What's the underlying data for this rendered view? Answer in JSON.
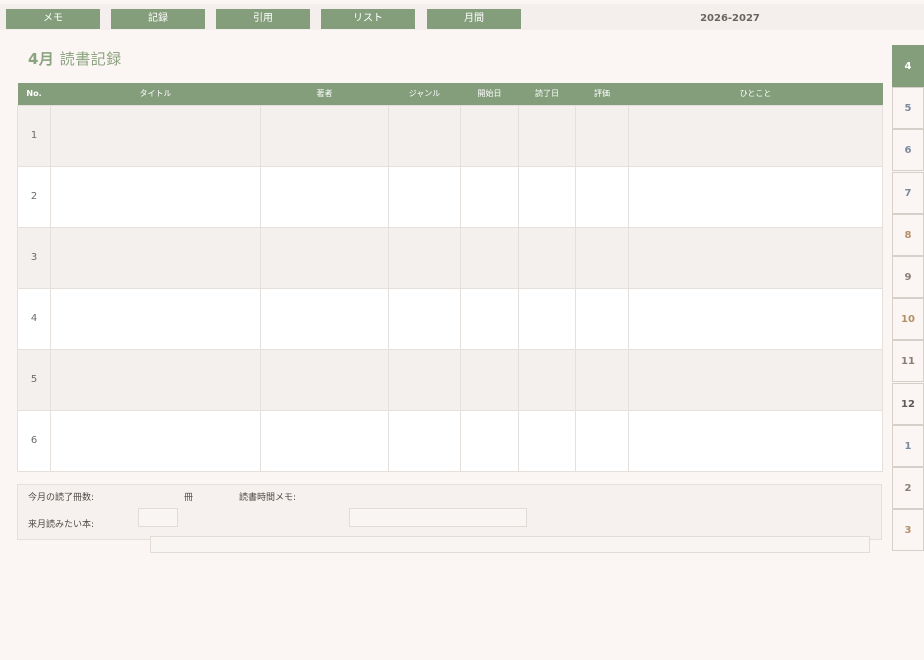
{
  "nav": {
    "buttons": [
      "メモ",
      "記録",
      "引用",
      "リスト",
      "月間"
    ],
    "year": "2026-2027"
  },
  "page": {
    "title_month": "4月",
    "title_text": " 読書記録"
  },
  "table": {
    "headers": [
      "No.",
      "タイトル",
      "著者",
      "ジャンル",
      "開始日",
      "読了日",
      "評価",
      "ひとこと"
    ],
    "rows": [
      "1",
      "2",
      "3",
      "4",
      "5",
      "6"
    ]
  },
  "footer": {
    "finished_label": "今月の読了冊数:",
    "unit": "冊",
    "memo_label": "読書時間メモ:",
    "next_label": "来月読みたい本:"
  },
  "side_tabs": {
    "labels": [
      "4",
      "5",
      "6",
      "7",
      "8",
      "9",
      "10",
      "11",
      "12",
      "1",
      "2",
      "3"
    ],
    "colors": [
      "#ffffff",
      "#7c8a9e",
      "#7c8a9e",
      "#7c8a9e",
      "#b4906a",
      "#8a7f76",
      "#b4906a",
      "#8a7f76",
      "#5e5a58",
      "#7c8a9e",
      "#8a7f76",
      "#b4906a"
    ],
    "active": "4"
  },
  "colors": {
    "accent": "#849e7c",
    "background": "#fbf6f3"
  }
}
